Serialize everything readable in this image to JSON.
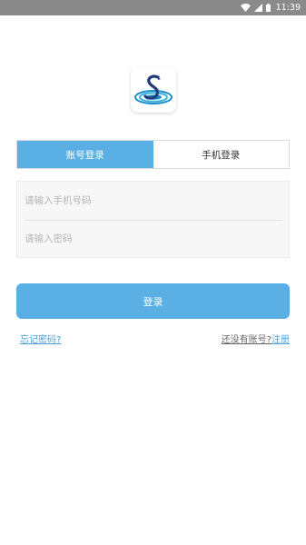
{
  "status_bar": {
    "time": "11:39",
    "icons": [
      "wifi-icon",
      "signal-icon",
      "battery-icon"
    ]
  },
  "logo": {
    "icon": "swan-logo-icon",
    "letter": "S"
  },
  "tabs": [
    {
      "label": "账号登录",
      "active": true
    },
    {
      "label": "手机登录",
      "active": false
    }
  ],
  "form": {
    "phone_placeholder": "请输入手机号码",
    "phone_value": "",
    "password_placeholder": "请输入密码",
    "password_value": ""
  },
  "login_button": {
    "label": "登录"
  },
  "links": {
    "forgot_password": "忘记密码?",
    "no_account": "还没有账号?",
    "register": "注册"
  },
  "colors": {
    "accent": "#5aafe4",
    "status_bar": "#8a8a8a",
    "link": "#4a9fd6",
    "form_bg": "#f7f7f7"
  }
}
